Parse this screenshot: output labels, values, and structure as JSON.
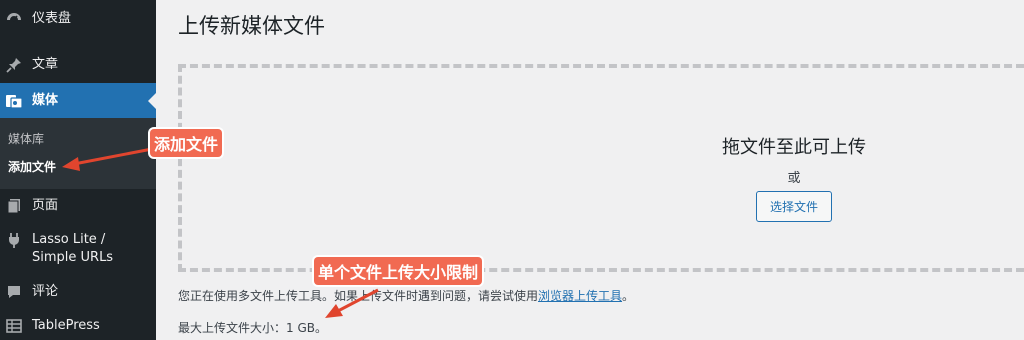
{
  "sidebar": {
    "items": [
      {
        "label": "仪表盘",
        "icon": "dashboard-icon"
      },
      {
        "label": "文章",
        "icon": "pin-icon"
      },
      {
        "label": "媒体",
        "icon": "media-icon"
      },
      {
        "label": "页面",
        "icon": "page-icon"
      },
      {
        "label": "Lasso Lite /\nSimple URLs",
        "icon": "plug-icon"
      },
      {
        "label": "评论",
        "icon": "comment-icon"
      },
      {
        "label": "TablePress",
        "icon": "table-icon"
      }
    ],
    "submenu": [
      {
        "label": "媒体库"
      },
      {
        "label": "添加文件"
      }
    ]
  },
  "main": {
    "title": "上传新媒体文件",
    "dropzone": {
      "title": "拖文件至此可上传",
      "or": "或",
      "button": "选择文件"
    },
    "notice_prefix": "您正在使用多文件上传工具。如果上传文件时遇到问题，请尝试使用",
    "notice_link": "浏览器上传工具",
    "notice_suffix": "。",
    "max_size": "最大上传文件大小：1 GB。"
  },
  "annotations": {
    "add_file": "添加文件",
    "size_limit": "单个文件上传大小限制"
  },
  "colors": {
    "sidebar_bg": "#1d2327",
    "accent": "#2271b1",
    "callout": "#f16a52"
  }
}
